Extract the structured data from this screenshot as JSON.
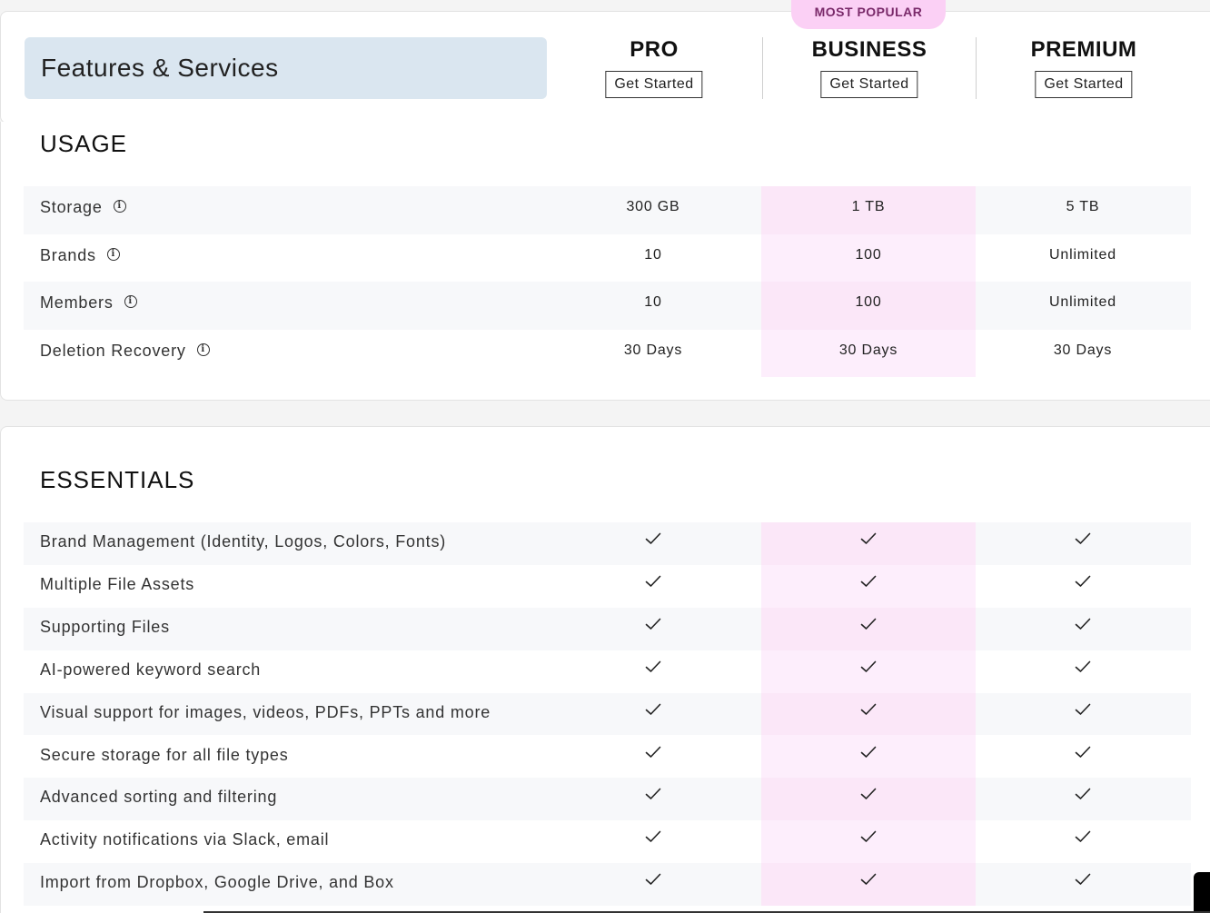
{
  "header": {
    "features_title": "Features & Services",
    "badge": "MOST POPULAR",
    "plans": [
      {
        "name": "PRO",
        "cta": "Get Started"
      },
      {
        "name": "BUSINESS",
        "cta": "Get Started"
      },
      {
        "name": "PREMIUM",
        "cta": "Get Started"
      }
    ]
  },
  "usage": {
    "title": "USAGE",
    "rows": [
      {
        "label": "Storage",
        "pro": "300 GB",
        "business": "1 TB",
        "premium": "5 TB"
      },
      {
        "label": "Brands",
        "pro": "10",
        "business": "100",
        "premium": "Unlimited"
      },
      {
        "label": "Members",
        "pro": "10",
        "business": "100",
        "premium": "Unlimited"
      },
      {
        "label": "Deletion Recovery",
        "pro": "30 Days",
        "business": "30 Days",
        "premium": "30 Days"
      }
    ]
  },
  "essentials": {
    "title": "ESSENTIALS",
    "rows": [
      {
        "label": "Brand Management (Identity, Logos, Colors, Fonts)"
      },
      {
        "label": "Multiple File Assets"
      },
      {
        "label": "Supporting Files"
      },
      {
        "label": "AI-powered keyword search"
      },
      {
        "label": "Visual support for images, videos, PDFs, PPTs and more"
      },
      {
        "label": "Secure storage for all file types"
      },
      {
        "label": "Advanced sorting and filtering"
      },
      {
        "label": "Activity notifications via Slack, email"
      },
      {
        "label": "Import from Dropbox, Google Drive, and Box"
      }
    ]
  },
  "icons": {
    "info": "info-icon",
    "check": "check-icon"
  },
  "colors": {
    "business_highlight": "#fdeefc",
    "badge": "#fbd0f5",
    "features_box": "#dae6f0"
  }
}
